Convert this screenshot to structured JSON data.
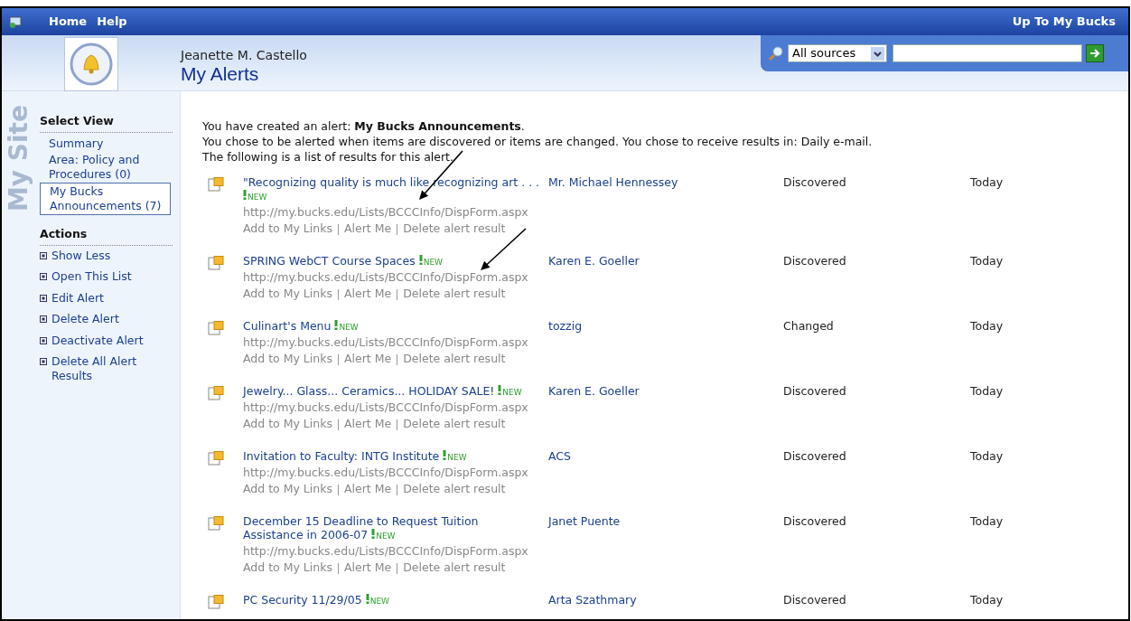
{
  "top_bar": {
    "links": [
      "Home",
      "Help"
    ],
    "up_link": "Up To My Bucks"
  },
  "header": {
    "user_name": "Jeanette M. Castello",
    "page_title": "My Alerts"
  },
  "search": {
    "scope": "All sources"
  },
  "side_label": "My Site",
  "sidebar": {
    "select_view": {
      "title": "Select View",
      "items": [
        {
          "label": "Summary",
          "selected": false
        },
        {
          "label": "Area: Policy and Procedures (0)",
          "selected": false
        },
        {
          "label": "My Bucks Announcements (7)",
          "selected": true
        }
      ]
    },
    "actions": {
      "title": "Actions",
      "items": [
        "Show Less",
        "Open This List",
        "Edit Alert",
        "Delete Alert",
        "Deactivate Alert",
        "Delete All Alert Results"
      ]
    }
  },
  "intro": [
    "You have created an alert: **My Bucks Announcements**.",
    "You chose to be alerted when items are discovered or items are changed. You chose to receive results in: Daily e-mail.",
    "The following is a list of results for this alert."
  ],
  "results": [
    {
      "title": "\"Recognizing quality is much like recognizing art . . .",
      "new_badge": "NEW",
      "url": "http://my.bucks.edu/Lists/BCCCInfo/DispForm.aspx",
      "links": [
        "Add to My Links",
        "Alert Me",
        "Delete alert result"
      ],
      "author": "Mr. Michael Hennessey",
      "status": "Discovered",
      "date": "Today"
    },
    {
      "title": "SPRING WebCT Course Spaces",
      "new_badge": "NEW",
      "url": "http://my.bucks.edu/Lists/BCCCInfo/DispForm.aspx",
      "links": [
        "Add to My Links",
        "Alert Me",
        "Delete alert result"
      ],
      "author": "Karen E. Goeller",
      "status": "Discovered",
      "date": "Today"
    },
    {
      "title": "Culinart's Menu",
      "new_badge": "NEW",
      "url": "http://my.bucks.edu/Lists/BCCCInfo/DispForm.aspx",
      "links": [
        "Add to My Links",
        "Alert Me",
        "Delete alert result"
      ],
      "author": "tozzig",
      "status": "Changed",
      "date": "Today"
    },
    {
      "title": "Jewelry... Glass... Ceramics... HOLIDAY SALE!",
      "new_badge": "NEW",
      "url": "http://my.bucks.edu/Lists/BCCCInfo/DispForm.aspx",
      "links": [
        "Add to My Links",
        "Alert Me",
        "Delete alert result"
      ],
      "author": "Karen E. Goeller",
      "status": "Discovered",
      "date": "Today"
    },
    {
      "title": "Invitation to Faculty: INTG Institute",
      "new_badge": "NEW",
      "url": "http://my.bucks.edu/Lists/BCCCInfo/DispForm.aspx",
      "links": [
        "Add to My Links",
        "Alert Me",
        "Delete alert result"
      ],
      "author": "ACS",
      "status": "Discovered",
      "date": "Today"
    },
    {
      "title": "December 15 Deadline to Request Tuition Assistance in 2006-07",
      "new_badge": "NEW",
      "url": "http://my.bucks.edu/Lists/BCCCInfo/DispForm.aspx",
      "links": [
        "Add to My Links",
        "Alert Me",
        "Delete alert result"
      ],
      "author": "Janet Puente",
      "status": "Discovered",
      "date": "Today"
    },
    {
      "title": "PC Security 11/29/05",
      "new_badge": "NEW",
      "author": "Arta Szathmary",
      "status": "Discovered",
      "date": "Today"
    }
  ]
}
